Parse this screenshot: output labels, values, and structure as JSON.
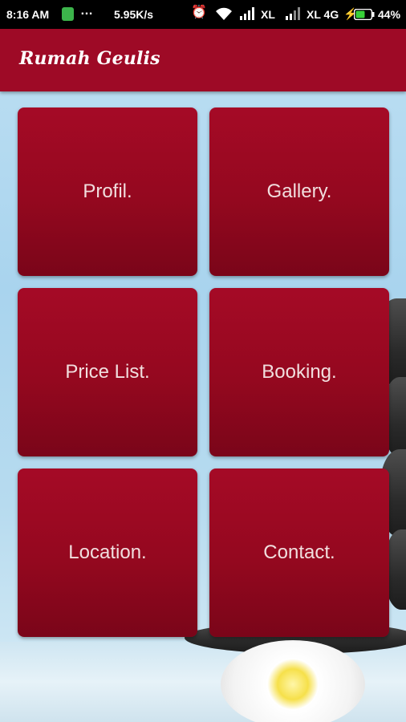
{
  "status_bar": {
    "time": "8:16 AM",
    "notification_icons": "…",
    "net_speed": "5.95K/s",
    "carrier1": "XL",
    "carrier2": "XL 4G",
    "battery": "44%"
  },
  "app_bar": {
    "title": "Rumah Geulis",
    "color": "#9e0a26"
  },
  "menu": {
    "tiles": [
      {
        "label": "Profil."
      },
      {
        "label": "Gallery."
      },
      {
        "label": "Price List."
      },
      {
        "label": "Booking."
      },
      {
        "label": "Location."
      },
      {
        "label": "Contact."
      }
    ],
    "tile_color": "#a50a26"
  }
}
